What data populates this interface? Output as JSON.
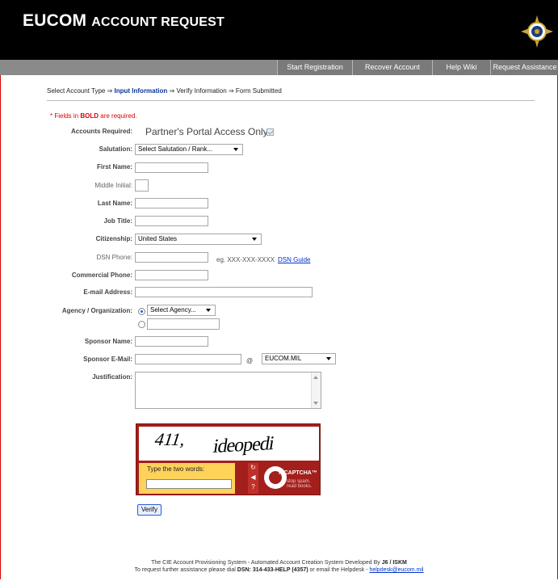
{
  "header": {
    "title_prefix": "EUCOM",
    "title_suffix": "Account Request"
  },
  "nav": [
    {
      "label": "Start Registration"
    },
    {
      "label": "Recover Account"
    },
    {
      "label": "Help Wiki"
    },
    {
      "label": "Request Assistance"
    }
  ],
  "breadcrumb": {
    "step1": "Select Account Type",
    "arrow": "⇒",
    "step2": "Input Information",
    "step3": "Verify Information",
    "step4": "Form Submitted"
  },
  "required_note": {
    "prefix": "* Fields in ",
    "bold": "BOLD",
    "suffix": " are required."
  },
  "form": {
    "accounts_required": {
      "label": "Accounts Required:",
      "value": "Partner's Portal Access Only:"
    },
    "salutation": {
      "label": "Salutation:",
      "value": "Select Salutation / Rank..."
    },
    "first_name": {
      "label": "First Name:",
      "value": ""
    },
    "middle_initial": {
      "label": "Middle Initial:",
      "value": ""
    },
    "last_name": {
      "label": "Last Name:",
      "value": ""
    },
    "job_title": {
      "label": "Job Title:",
      "value": ""
    },
    "citizenship": {
      "label": "Citizenship:",
      "value": "United States"
    },
    "dsn_phone": {
      "label": "DSN Phone:",
      "value": "",
      "hint": "eg. XXX-XXX-XXXX",
      "link": "DSN Guide"
    },
    "commercial_phone": {
      "label": "Commercial Phone:",
      "value": ""
    },
    "email": {
      "label": "E-mail Address:",
      "value": ""
    },
    "agency": {
      "label": "Agency / Organization:",
      "select_value": "Select Agency...",
      "other_value": ""
    },
    "sponsor_name": {
      "label": "Sponsor Name:",
      "value": ""
    },
    "sponsor_email": {
      "label": "Sponsor E-Mail:",
      "value": "",
      "at": "@",
      "domain": "EUCOM.MIL"
    },
    "justification": {
      "label": "Justification:",
      "value": ""
    }
  },
  "captcha": {
    "word1": "411,",
    "word2": "ideopedi",
    "type_label": "Type the two words:",
    "logo_text": "reCAPTCHA™",
    "logo_small": "stop spam. read books."
  },
  "verify_label": "Verify",
  "footer": {
    "line1_prefix": "The CIE Account Provisioning System - Automated Account Creation System Developed By ",
    "line1_bold": "J6 / ISKM",
    "line2_prefix": "To request further assistance please dial ",
    "line2_bold": "DSN: 314-433-HELP (4357)",
    "line2_mid": " or email the Helpdesk - ",
    "line2_mail": "helpdesk@eucom.mil"
  }
}
